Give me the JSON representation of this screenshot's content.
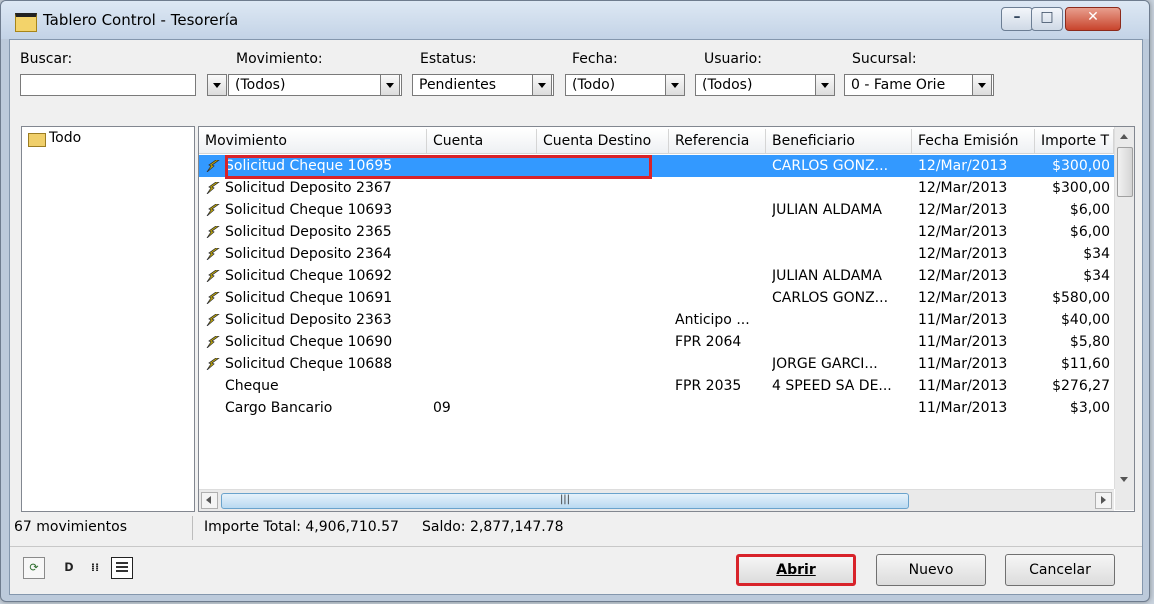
{
  "window": {
    "title": "Tablero Control - Tesorería"
  },
  "filters": {
    "buscar": {
      "label": "Buscar:",
      "value": ""
    },
    "movimiento": {
      "label": "Movimiento:",
      "value": "(Todos)"
    },
    "estatus": {
      "label": "Estatus:",
      "value": "Pendientes"
    },
    "fecha": {
      "label": "Fecha:",
      "value": "(Todo)"
    },
    "usuario": {
      "label": "Usuario:",
      "value": "(Todos)"
    },
    "sucursal": {
      "label": "Sucursal:",
      "value": "0 - Fame Orie"
    }
  },
  "tree": {
    "root_label": "Todo"
  },
  "grid": {
    "columns": [
      "Movimiento",
      "Cuenta",
      "Cuenta Destino",
      "Referencia",
      "Beneficiario",
      "Fecha Emisión",
      "Importe T"
    ],
    "rows": [
      {
        "movimiento": "Solicitud Cheque 10695",
        "cuenta": "",
        "cuenta_destino": "",
        "referencia": "",
        "beneficiario": "CARLOS GONZ...",
        "fecha": "12/Mar/2013",
        "importe": "$300,00",
        "icon": "lightning-icon",
        "selected": true
      },
      {
        "movimiento": "Solicitud Deposito 2367",
        "cuenta": "",
        "cuenta_destino": "",
        "referencia": "",
        "beneficiario": "",
        "fecha": "12/Mar/2013",
        "importe": "$300,00",
        "icon": "lightning-icon",
        "selected": false
      },
      {
        "movimiento": "Solicitud Cheque 10693",
        "cuenta": "",
        "cuenta_destino": "",
        "referencia": "",
        "beneficiario": "JULIAN ALDAMA",
        "fecha": "12/Mar/2013",
        "importe": "$6,00",
        "icon": "lightning-icon",
        "selected": false
      },
      {
        "movimiento": "Solicitud Deposito 2365",
        "cuenta": "",
        "cuenta_destino": "",
        "referencia": "",
        "beneficiario": "",
        "fecha": "12/Mar/2013",
        "importe": "$6,00",
        "icon": "lightning-icon",
        "selected": false
      },
      {
        "movimiento": "Solicitud Deposito 2364",
        "cuenta": "",
        "cuenta_destino": "",
        "referencia": "",
        "beneficiario": "",
        "fecha": "12/Mar/2013",
        "importe": "$34",
        "icon": "lightning-icon",
        "selected": false
      },
      {
        "movimiento": "Solicitud Cheque 10692",
        "cuenta": "",
        "cuenta_destino": "",
        "referencia": "",
        "beneficiario": "JULIAN ALDAMA",
        "fecha": "12/Mar/2013",
        "importe": "$34",
        "icon": "lightning-icon",
        "selected": false
      },
      {
        "movimiento": "Solicitud Cheque 10691",
        "cuenta": "",
        "cuenta_destino": "",
        "referencia": "",
        "beneficiario": "CARLOS GONZ...",
        "fecha": "12/Mar/2013",
        "importe": "$580,00",
        "icon": "lightning-icon",
        "selected": false
      },
      {
        "movimiento": "Solicitud Deposito 2363",
        "cuenta": "",
        "cuenta_destino": "",
        "referencia": "Anticipo ...",
        "beneficiario": "",
        "fecha": "11/Mar/2013",
        "importe": "$40,00",
        "icon": "lightning-icon",
        "selected": false
      },
      {
        "movimiento": "Solicitud Cheque 10690",
        "cuenta": "",
        "cuenta_destino": "",
        "referencia": "FPR 2064",
        "beneficiario": "",
        "fecha": "11/Mar/2013",
        "importe": "$5,80",
        "icon": "lightning-icon",
        "selected": false
      },
      {
        "movimiento": "Solicitud Cheque 10688",
        "cuenta": "",
        "cuenta_destino": "",
        "referencia": "",
        "beneficiario": "JORGE GARCI...",
        "fecha": "11/Mar/2013",
        "importe": "$11,60",
        "icon": "lightning-icon",
        "selected": false
      },
      {
        "movimiento": "Cheque",
        "cuenta": "",
        "cuenta_destino": "",
        "referencia": "FPR 2035",
        "beneficiario": "4 SPEED SA DE...",
        "fecha": "11/Mar/2013",
        "importe": "$276,27",
        "icon": "",
        "selected": false
      },
      {
        "movimiento": "Cargo Bancario",
        "cuenta": "09",
        "cuenta_destino": "",
        "referencia": "",
        "beneficiario": "",
        "fecha": "11/Mar/2013",
        "importe": "$3,00",
        "icon": "",
        "selected": false
      }
    ]
  },
  "status": {
    "count": "67 movimientos",
    "importe_total": "Importe Total: 4,906,710.57",
    "saldo": "Saldo: 2,877,147.78"
  },
  "buttons": {
    "abrir": "Abrir",
    "nuevo": "Nuevo",
    "cancelar": "Cancelar"
  },
  "toolbar": {
    "icons": [
      "refresh-icon",
      "detail-view-icon",
      "list-view-icon",
      "grid-view-icon"
    ]
  },
  "colors": {
    "selection": "#3399ff",
    "highlight_box": "#d8232a",
    "lightning": "#d4b800"
  }
}
